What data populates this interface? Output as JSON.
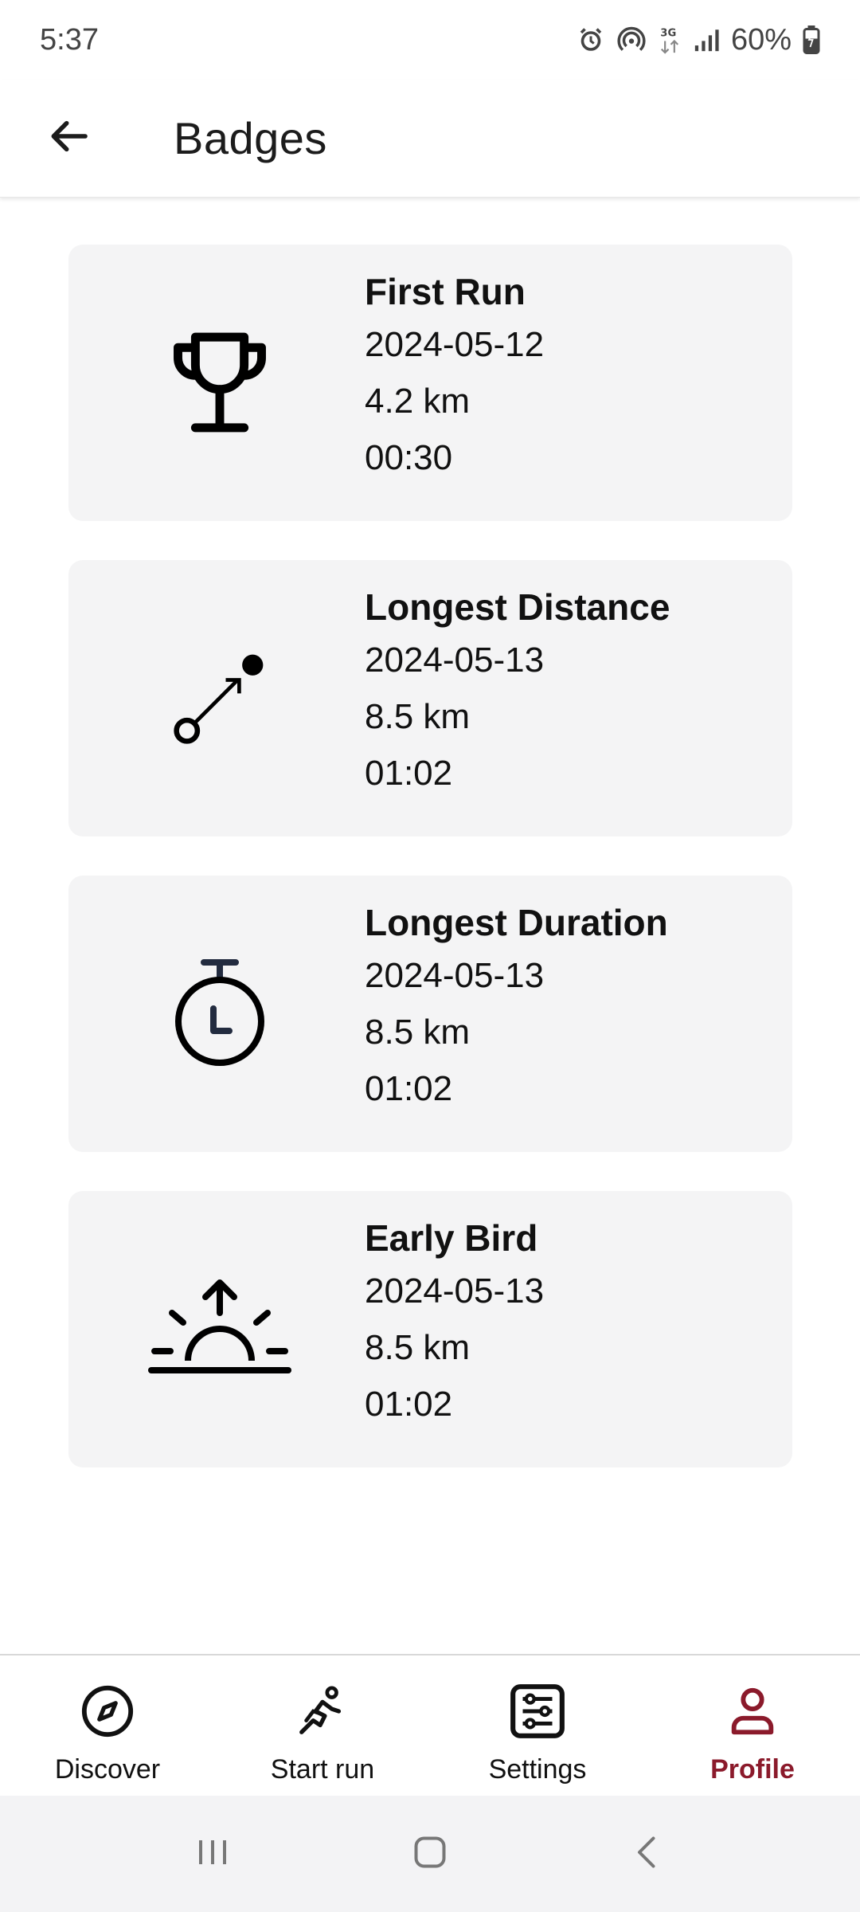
{
  "status_bar": {
    "time": "5:37",
    "battery": "60%",
    "network": "3G",
    "icons": [
      "alarm-icon",
      "hotspot-icon",
      "3g-icon",
      "signal-icon",
      "battery-icon"
    ]
  },
  "header": {
    "title": "Badges",
    "back_icon": "arrow-left-icon"
  },
  "badges": [
    {
      "icon": "trophy-icon",
      "title": "First Run",
      "date": "2024-05-12",
      "distance": "4.2 km",
      "duration": "00:30"
    },
    {
      "icon": "distance-icon",
      "title": "Longest Distance",
      "date": "2024-05-13",
      "distance": "8.5 km",
      "duration": "01:02"
    },
    {
      "icon": "stopwatch-icon",
      "title": "Longest Duration",
      "date": "2024-05-13",
      "distance": "8.5 km",
      "duration": "01:02"
    },
    {
      "icon": "sunrise-icon",
      "title": "Early Bird",
      "date": "2024-05-13",
      "distance": "8.5 km",
      "duration": "01:02"
    }
  ],
  "bottom_nav": {
    "items": [
      {
        "label": "Discover",
        "icon": "compass-icon"
      },
      {
        "label": "Start run",
        "icon": "runner-icon"
      },
      {
        "label": "Settings",
        "icon": "sliders-icon"
      },
      {
        "label": "Profile",
        "icon": "person-icon"
      }
    ],
    "active": "Profile"
  },
  "colors": {
    "accent": "#8b1a2b",
    "card_background": "#f4f4f5",
    "system_nav_background": "#f3f3f5"
  }
}
